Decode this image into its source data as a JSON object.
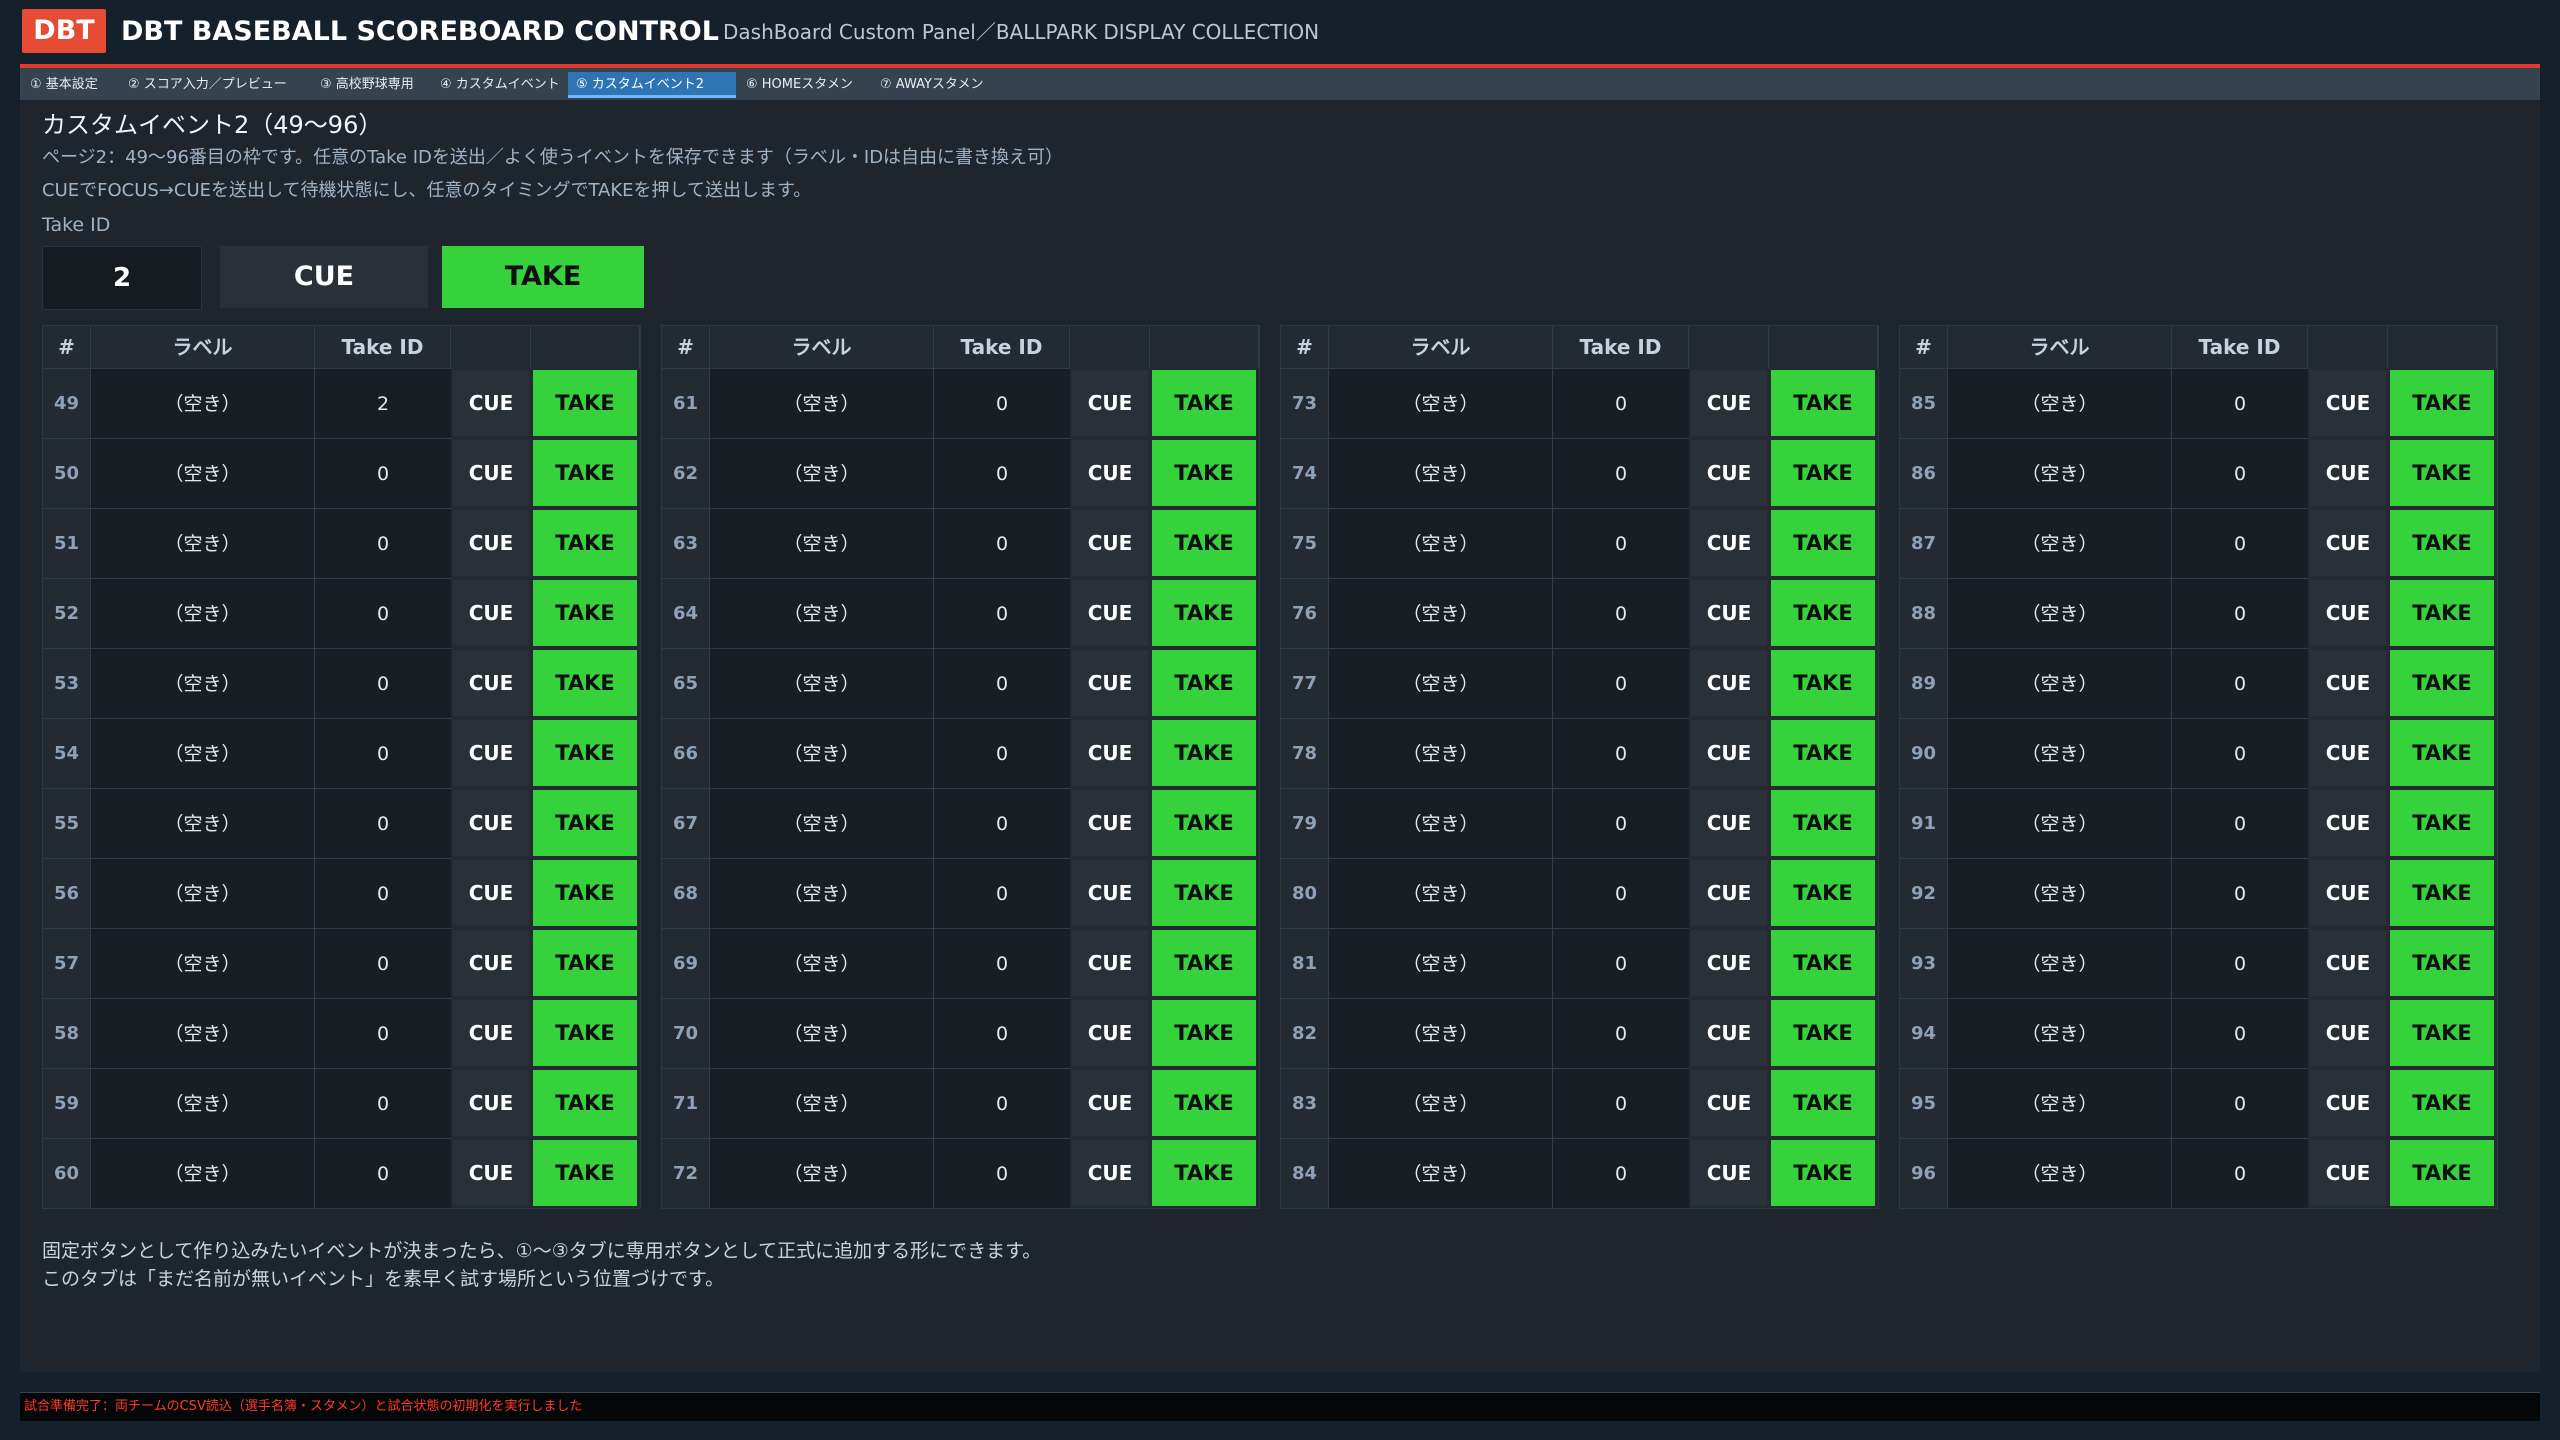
{
  "header": {
    "logo": "DBT",
    "title": "DBT BASEBALL SCOREBOARD CONTROL",
    "subtitle": "DashBoard Custom Panel／BALLPARK DISPLAY COLLECTION"
  },
  "tabs": [
    {
      "label": "① 基本設定",
      "active": false
    },
    {
      "label": "② スコア入力／プレビュー",
      "active": false
    },
    {
      "label": "③ 高校野球専用",
      "active": false
    },
    {
      "label": "④ カスタムイベント",
      "active": false
    },
    {
      "label": "⑤ カスタムイベント2",
      "active": true
    },
    {
      "label": "⑥ HOMEスタメン",
      "active": false
    },
    {
      "label": "⑦ AWAYスタメン",
      "active": false
    }
  ],
  "page": {
    "title": "カスタムイベント2（49〜96）",
    "desc1": "ページ2：49〜96番目の枠です。任意のTake IDを送出／よく使うイベントを保存できます（ラベル・IDは自由に書き換え可）",
    "desc2": "CUEでFOCUS→CUEを送出して待機状態にし、任意のタイミングでTAKEを押して送出します。",
    "take_id_label": "Take ID",
    "take_id_value": "2",
    "cue_label": "CUE",
    "take_label": "TAKE"
  },
  "table": {
    "headers": {
      "num": "#",
      "label": "ラベル",
      "take_id": "Take ID"
    },
    "cue_label": "CUE",
    "take_label": "TAKE",
    "columns": [
      {
        "rows": [
          {
            "num": "49",
            "label": "（空き）",
            "take_id": "2"
          },
          {
            "num": "50",
            "label": "（空き）",
            "take_id": "0"
          },
          {
            "num": "51",
            "label": "（空き）",
            "take_id": "0"
          },
          {
            "num": "52",
            "label": "（空き）",
            "take_id": "0"
          },
          {
            "num": "53",
            "label": "（空き）",
            "take_id": "0"
          },
          {
            "num": "54",
            "label": "（空き）",
            "take_id": "0"
          },
          {
            "num": "55",
            "label": "（空き）",
            "take_id": "0"
          },
          {
            "num": "56",
            "label": "（空き）",
            "take_id": "0"
          },
          {
            "num": "57",
            "label": "（空き）",
            "take_id": "0"
          },
          {
            "num": "58",
            "label": "（空き）",
            "take_id": "0"
          },
          {
            "num": "59",
            "label": "（空き）",
            "take_id": "0"
          },
          {
            "num": "60",
            "label": "（空き）",
            "take_id": "0"
          }
        ]
      },
      {
        "rows": [
          {
            "num": "61",
            "label": "（空き）",
            "take_id": "0"
          },
          {
            "num": "62",
            "label": "（空き）",
            "take_id": "0"
          },
          {
            "num": "63",
            "label": "（空き）",
            "take_id": "0"
          },
          {
            "num": "64",
            "label": "（空き）",
            "take_id": "0"
          },
          {
            "num": "65",
            "label": "（空き）",
            "take_id": "0"
          },
          {
            "num": "66",
            "label": "（空き）",
            "take_id": "0"
          },
          {
            "num": "67",
            "label": "（空き）",
            "take_id": "0"
          },
          {
            "num": "68",
            "label": "（空き）",
            "take_id": "0"
          },
          {
            "num": "69",
            "label": "（空き）",
            "take_id": "0"
          },
          {
            "num": "70",
            "label": "（空き）",
            "take_id": "0"
          },
          {
            "num": "71",
            "label": "（空き）",
            "take_id": "0"
          },
          {
            "num": "72",
            "label": "（空き）",
            "take_id": "0"
          }
        ]
      },
      {
        "rows": [
          {
            "num": "73",
            "label": "（空き）",
            "take_id": "0"
          },
          {
            "num": "74",
            "label": "（空き）",
            "take_id": "0"
          },
          {
            "num": "75",
            "label": "（空き）",
            "take_id": "0"
          },
          {
            "num": "76",
            "label": "（空き）",
            "take_id": "0"
          },
          {
            "num": "77",
            "label": "（空き）",
            "take_id": "0"
          },
          {
            "num": "78",
            "label": "（空き）",
            "take_id": "0"
          },
          {
            "num": "79",
            "label": "（空き）",
            "take_id": "0"
          },
          {
            "num": "80",
            "label": "（空き）",
            "take_id": "0"
          },
          {
            "num": "81",
            "label": "（空き）",
            "take_id": "0"
          },
          {
            "num": "82",
            "label": "（空き）",
            "take_id": "0"
          },
          {
            "num": "83",
            "label": "（空き）",
            "take_id": "0"
          },
          {
            "num": "84",
            "label": "（空き）",
            "take_id": "0"
          }
        ]
      },
      {
        "rows": [
          {
            "num": "85",
            "label": "（空き）",
            "take_id": "0"
          },
          {
            "num": "86",
            "label": "（空き）",
            "take_id": "0"
          },
          {
            "num": "87",
            "label": "（空き）",
            "take_id": "0"
          },
          {
            "num": "88",
            "label": "（空き）",
            "take_id": "0"
          },
          {
            "num": "89",
            "label": "（空き）",
            "take_id": "0"
          },
          {
            "num": "90",
            "label": "（空き）",
            "take_id": "0"
          },
          {
            "num": "91",
            "label": "（空き）",
            "take_id": "0"
          },
          {
            "num": "92",
            "label": "（空き）",
            "take_id": "0"
          },
          {
            "num": "93",
            "label": "（空き）",
            "take_id": "0"
          },
          {
            "num": "94",
            "label": "（空き）",
            "take_id": "0"
          },
          {
            "num": "95",
            "label": "（空き）",
            "take_id": "0"
          },
          {
            "num": "96",
            "label": "（空き）",
            "take_id": "0"
          }
        ]
      }
    ]
  },
  "footer": {
    "note1": "固定ボタンとして作り込みたいイベントが決まったら、①〜③タブに専用ボタンとして正式に追加する形にできます。",
    "note2": "このタブは「まだ名前が無いイベント」を素早く試す場所という位置づけです。"
  },
  "status": {
    "text": "試合準備完了：両チームのCSV読込（選手名簿・スタメン）と試合状態の初期化を実行しました"
  },
  "colors": {
    "accent_red": "#e64b33",
    "take_green": "#36d23c",
    "tab_active": "#2e74b5",
    "status_red": "#ff3a2a"
  }
}
